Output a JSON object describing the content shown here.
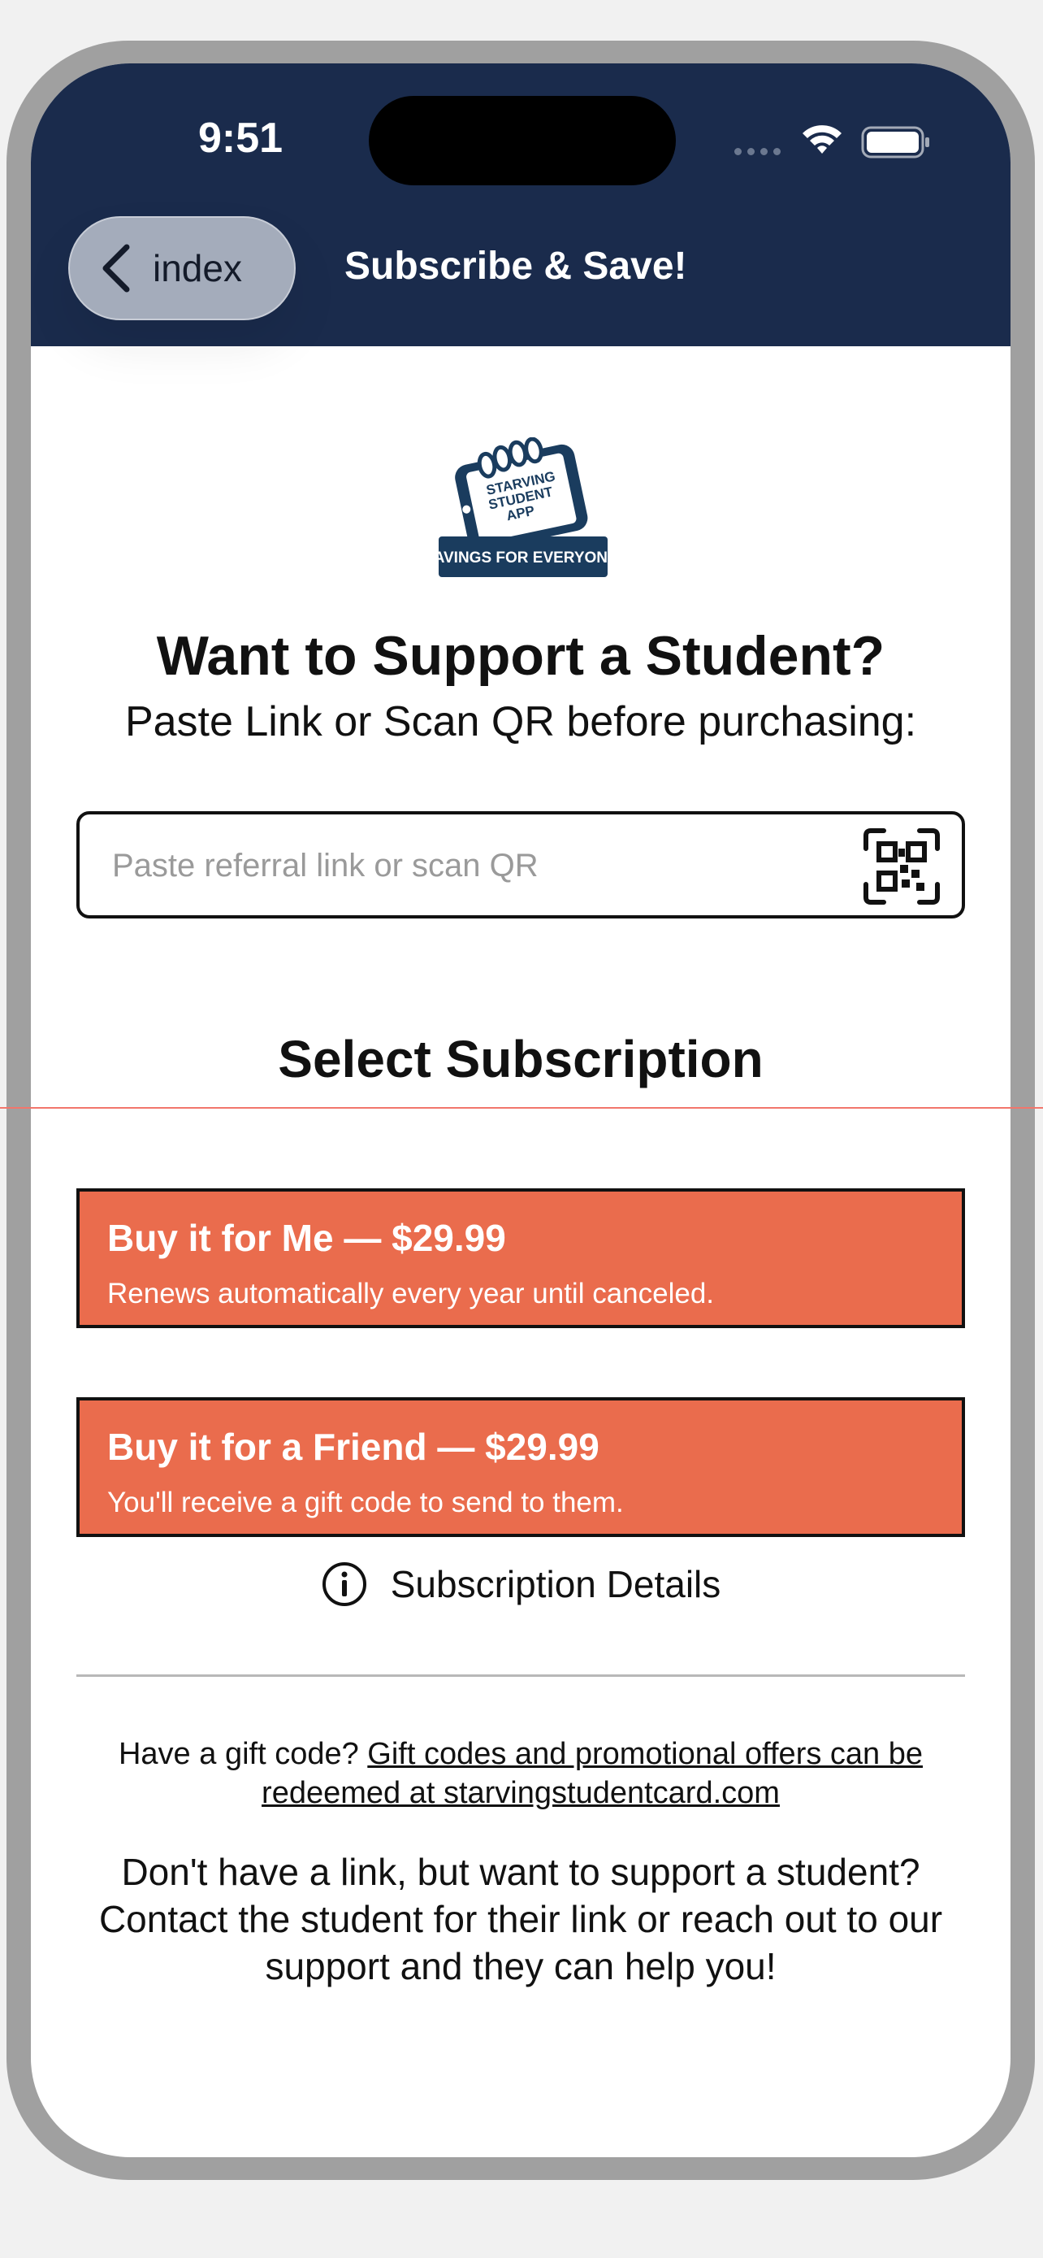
{
  "status_bar": {
    "time": "9:51"
  },
  "nav": {
    "back_label": "index",
    "title": "Subscribe & Save!"
  },
  "logo": {
    "lines": [
      "STARVING",
      "STUDENT",
      "APP"
    ],
    "banner": "SAVINGS FOR EVERYONE!",
    "brand_color": "#1a3c5e"
  },
  "heading": "Want to Support a Student?",
  "subheading": "Paste Link or Scan QR before purchasing:",
  "referral": {
    "placeholder": "Paste referral link or scan QR",
    "value": ""
  },
  "section_title": "Select Subscription",
  "plans": [
    {
      "title": "Buy it for Me — $29.99",
      "subtitle": "Renews automatically every year until canceled."
    },
    {
      "title": "Buy it for a Friend — $29.99",
      "subtitle": "You'll receive a gift code to send to them."
    }
  ],
  "details_label": "Subscription Details",
  "gift": {
    "prefix": "Have a gift code? ",
    "link": "Gift codes and promotional offers can be redeemed at starvingstudentcard.com"
  },
  "support_text": "Don't have a link, but want to support a student? Contact the student for their link or reach out to our support and they can help you!",
  "icons": {
    "back": "chevron-left-icon",
    "qr": "qr-code-scan-icon",
    "info": "info-circle-icon",
    "wifi": "wifi-icon",
    "battery": "battery-icon"
  },
  "colors": {
    "header_bg": "#1a2b4c",
    "accent": "#ea6c4d",
    "back_button_bg": "#a4acbb"
  }
}
